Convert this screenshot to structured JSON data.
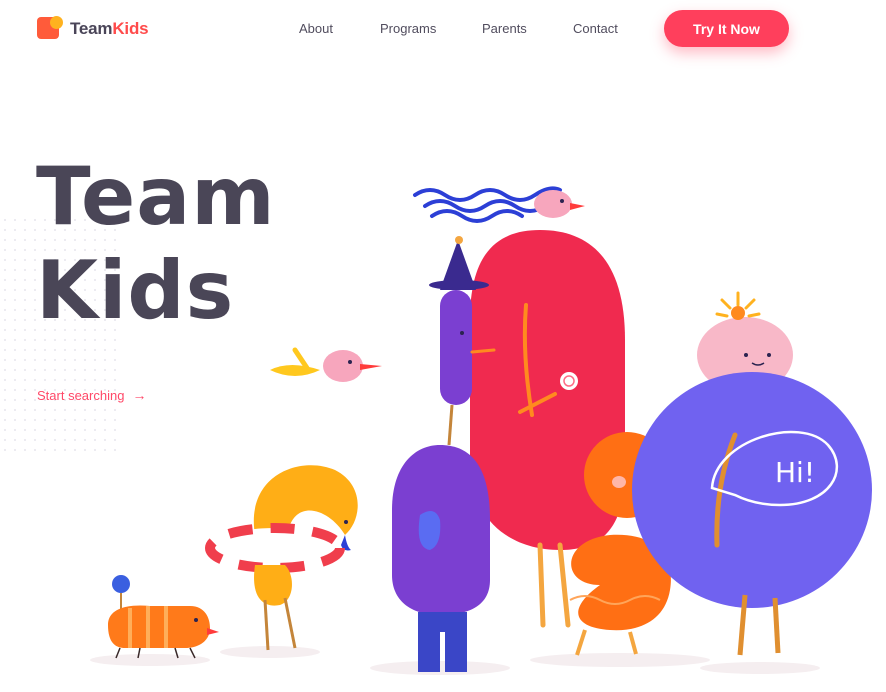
{
  "brand": {
    "name_part1": "Team",
    "name_part2": "Kids"
  },
  "nav": {
    "links": [
      {
        "label": "About"
      },
      {
        "label": "Programs"
      },
      {
        "label": "Parents"
      },
      {
        "label": "Contact"
      }
    ],
    "cta_label": "Try It Now"
  },
  "hero": {
    "title_line1": "Team",
    "title_line2": "Kids",
    "link_label": "Start searching",
    "link_arrow": "→"
  },
  "illustration": {
    "speech_bubble_text": "Hi!"
  },
  "colors": {
    "accent": "#ff3f5c",
    "heading": "#4a4657",
    "logo_orange": "#ff5b3a",
    "logo_yellow": "#ffb21f"
  }
}
